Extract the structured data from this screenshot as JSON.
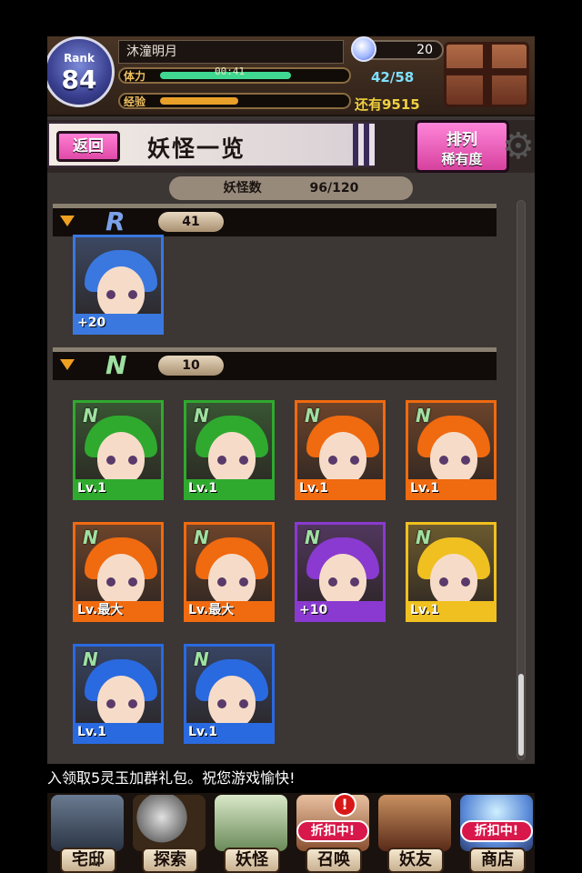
{
  "player": {
    "rank_label": "Rank",
    "rank": "84",
    "name": "沐潼明月",
    "stamina_label": "体力",
    "stamina_timer": "00:41",
    "stamina_value": "42/58",
    "stamina_fraction": 0.72,
    "exp_label": "经验",
    "exp_fraction": 0.43,
    "exp_remaining": "还有9515",
    "gems": "20"
  },
  "header": {
    "back_label": "返回",
    "title": "妖怪一览",
    "sort_line1": "排列",
    "sort_line2": "稀有度"
  },
  "list": {
    "count_label": "妖怪数",
    "count_value": "96/120",
    "sections": [
      {
        "rarity": "R",
        "count": "41"
      },
      {
        "rarity": "N",
        "count": "10"
      }
    ],
    "r_cards": [
      {
        "label": "+20",
        "frame": "#3a78e0"
      }
    ],
    "n_cards": [
      {
        "label": "Lv.1",
        "frame": "#2faa2f"
      },
      {
        "label": "Lv.1",
        "frame": "#2faa2f"
      },
      {
        "label": "Lv.1",
        "frame": "#f06a10"
      },
      {
        "label": "Lv.1",
        "frame": "#f06a10"
      },
      {
        "label": "Lv.最大",
        "frame": "#f06a10"
      },
      {
        "label": "Lv.最大",
        "frame": "#f06a10"
      },
      {
        "label": "+10",
        "frame": "#8a3ad0"
      },
      {
        "label": "Lv.1",
        "frame": "#f0c020"
      },
      {
        "label": "Lv.1",
        "frame": "#2a6ae0"
      },
      {
        "label": "Lv.1",
        "frame": "#2a6ae0"
      }
    ]
  },
  "ticker": "入领取5灵玉加群礼包。祝您游戏愉快!",
  "nav": {
    "items": [
      {
        "label": "宅邸",
        "icon": "house-icon"
      },
      {
        "label": "探索",
        "icon": "magnifier-icon"
      },
      {
        "label": "妖怪",
        "icon": "scroll-icon"
      },
      {
        "label": "召唤",
        "icon": "summon-icon",
        "sale": "折扣中!",
        "alert": "!"
      },
      {
        "label": "妖友",
        "icon": "friend-icon"
      },
      {
        "label": "商店",
        "icon": "shop-icon",
        "sale": "折扣中!"
      }
    ]
  },
  "colors": {
    "accent_pink": "#e04aa8",
    "stamina_bar": "#40d890",
    "exp_bar": "#e8a028",
    "rarity_R": "#7aa0e8",
    "rarity_N": "#9fe0a0"
  }
}
